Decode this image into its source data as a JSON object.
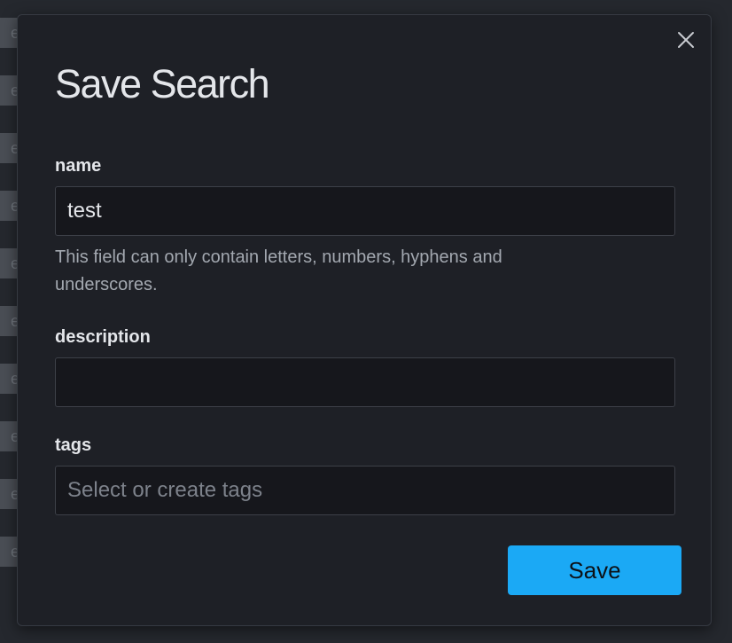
{
  "dialog": {
    "title": "Save Search",
    "close_icon": "close-icon"
  },
  "form": {
    "name": {
      "label": "name",
      "value": "test",
      "help": "This field can only contain letters, numbers, hyphens and underscores."
    },
    "description": {
      "label": "description",
      "value": "",
      "placeholder": ""
    },
    "tags": {
      "label": "tags",
      "value": "",
      "placeholder": "Select or create tags"
    }
  },
  "actions": {
    "save_label": "Save"
  },
  "colors": {
    "accent": "#1ba9f5",
    "dialog_background": "#1e2026",
    "input_background": "#16171c"
  }
}
